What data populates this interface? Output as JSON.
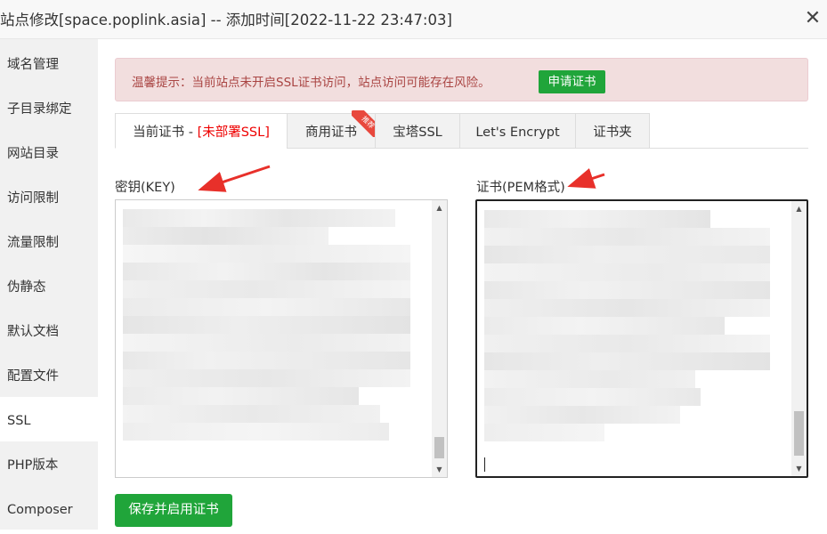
{
  "window": {
    "title": "站点修改[space.poplink.asia] -- 添加时间[2022-11-22 23:47:03]"
  },
  "sidebar": {
    "items": [
      {
        "label": "域名管理"
      },
      {
        "label": "子目录绑定"
      },
      {
        "label": "网站目录"
      },
      {
        "label": "访问限制"
      },
      {
        "label": "流量限制"
      },
      {
        "label": "伪静态"
      },
      {
        "label": "默认文档"
      },
      {
        "label": "配置文件"
      },
      {
        "label": "SSL",
        "active": true
      },
      {
        "label": "PHP版本"
      },
      {
        "label": "Composer"
      }
    ]
  },
  "alert": {
    "text": "温馨提示：当前站点未开启SSL证书访问，站点访问可能存在风险。",
    "button": "申请证书"
  },
  "tabs": [
    {
      "label": "当前证书 - ",
      "status": "[未部署SSL]"
    },
    {
      "label": "商用证书",
      "badge": "推荐"
    },
    {
      "label": "宝塔SSL"
    },
    {
      "label": "Let's Encrypt"
    },
    {
      "label": "证书夹"
    }
  ],
  "key_field": {
    "label": "密钥(KEY)"
  },
  "cert_field": {
    "label": "证书(PEM格式)"
  },
  "save_button": "保存并启用证书",
  "colors": {
    "accent": "#20a53a",
    "alert_bg": "#f2dede",
    "alert_text": "#a94442",
    "arrow": "#e8302a"
  }
}
